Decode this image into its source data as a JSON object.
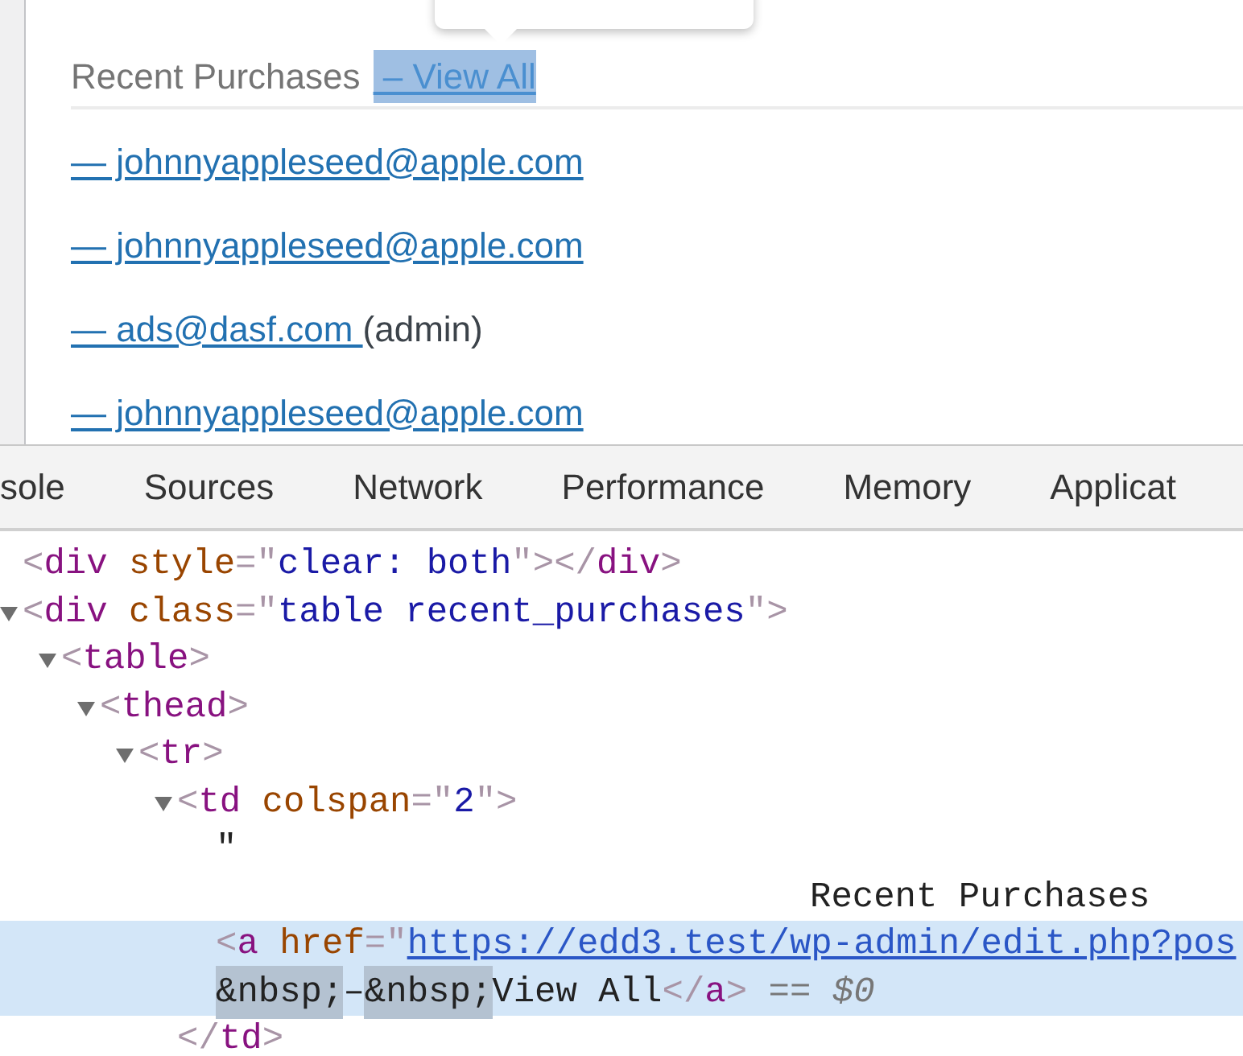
{
  "page": {
    "heading": "Recent Purchases",
    "view_all": {
      "text": " – View All",
      "highlighted": true
    },
    "purchases": [
      {
        "email": "— johnnyappleseed@apple.com"
      },
      {
        "email": "— johnnyappleseed@apple.com"
      },
      {
        "email": "— ads@dasf.com ",
        "suffix": "(admin)"
      },
      {
        "email": "— johnnyappleseed@apple.com"
      }
    ]
  },
  "devtools": {
    "tabs": [
      "sole",
      "Sources",
      "Network",
      "Performance",
      "Memory",
      "Applicat"
    ],
    "tree": [
      {
        "selected": false,
        "lines": [
          [
            {
              "kind": "punct",
              "text": "<"
            },
            {
              "kind": "tag",
              "text": "div"
            },
            {
              "kind": "attr",
              "text": " style"
            },
            {
              "kind": "punct",
              "text": "=\""
            },
            {
              "kind": "value",
              "text": "clear: both"
            },
            {
              "kind": "punct",
              "text": "\"></"
            },
            {
              "kind": "tag",
              "text": "div"
            },
            {
              "kind": "punct",
              "text": ">"
            }
          ]
        ]
      },
      {
        "selected": false,
        "expanded": true,
        "lines": [
          [
            {
              "kind": "punct",
              "text": "<"
            },
            {
              "kind": "tag",
              "text": "div"
            },
            {
              "kind": "attr",
              "text": " class"
            },
            {
              "kind": "punct",
              "text": "=\""
            },
            {
              "kind": "value",
              "text": "table recent_purchases"
            },
            {
              "kind": "punct",
              "text": "\">"
            }
          ]
        ],
        "children": [
          {
            "selected": false,
            "expanded": true,
            "lines": [
              [
                {
                  "kind": "punct",
                  "text": "<"
                },
                {
                  "kind": "tag",
                  "text": "table"
                },
                {
                  "kind": "punct",
                  "text": ">"
                }
              ]
            ],
            "children": [
              {
                "selected": false,
                "expanded": true,
                "lines": [
                  [
                    {
                      "kind": "punct",
                      "text": "<"
                    },
                    {
                      "kind": "tag",
                      "text": "thead"
                    },
                    {
                      "kind": "punct",
                      "text": ">"
                    }
                  ]
                ],
                "children": [
                  {
                    "selected": false,
                    "expanded": true,
                    "lines": [
                      [
                        {
                          "kind": "punct",
                          "text": "<"
                        },
                        {
                          "kind": "tag",
                          "text": "tr"
                        },
                        {
                          "kind": "punct",
                          "text": ">"
                        }
                      ]
                    ],
                    "children": [
                      {
                        "selected": false,
                        "expanded": true,
                        "lines": [
                          [
                            {
                              "kind": "punct",
                              "text": "<"
                            },
                            {
                              "kind": "tag",
                              "text": "td"
                            },
                            {
                              "kind": "attr",
                              "text": " colspan"
                            },
                            {
                              "kind": "punct",
                              "text": "=\""
                            },
                            {
                              "kind": "value",
                              "text": "2"
                            },
                            {
                              "kind": "punct",
                              "text": "\">"
                            }
                          ]
                        ],
                        "children": [
                          {
                            "selected": false,
                            "lines": [
                              [
                                {
                                  "kind": "text",
                                  "text": "\""
                                }
                              ],
                              [
                                {
                                  "kind": "spaced",
                                  "text": "Recent Purchases"
                                }
                              ]
                            ]
                          },
                          {
                            "selected": true,
                            "lines": [
                              [
                                {
                                  "kind": "punct",
                                  "text": "<"
                                },
                                {
                                  "kind": "tag",
                                  "text": "a"
                                },
                                {
                                  "kind": "attr",
                                  "text": " href"
                                },
                                {
                                  "kind": "punct",
                                  "text": "=\""
                                },
                                {
                                  "kind": "link",
                                  "text": "https://edd3.test/wp-admin/edit.php?pos"
                                }
                              ],
                              [
                                {
                                  "kind": "entity",
                                  "text": "&nbsp;"
                                },
                                {
                                  "kind": "text",
                                  "text": "–"
                                },
                                {
                                  "kind": "entity",
                                  "text": "&nbsp;"
                                },
                                {
                                  "kind": "text",
                                  "text": "View All"
                                },
                                {
                                  "kind": "punct",
                                  "text": "</"
                                },
                                {
                                  "kind": "tag",
                                  "text": "a"
                                },
                                {
                                  "kind": "punct",
                                  "text": ">"
                                },
                                {
                                  "kind": "comment",
                                  "text": " == $0"
                                }
                              ]
                            ]
                          }
                        ],
                        "close": [
                          {
                            "kind": "punct",
                            "text": "</"
                          },
                          {
                            "kind": "tag",
                            "text": "td"
                          },
                          {
                            "kind": "punct",
                            "text": ">"
                          }
                        ]
                      }
                    ]
                  }
                ]
              }
            ]
          }
        ]
      }
    ]
  }
}
